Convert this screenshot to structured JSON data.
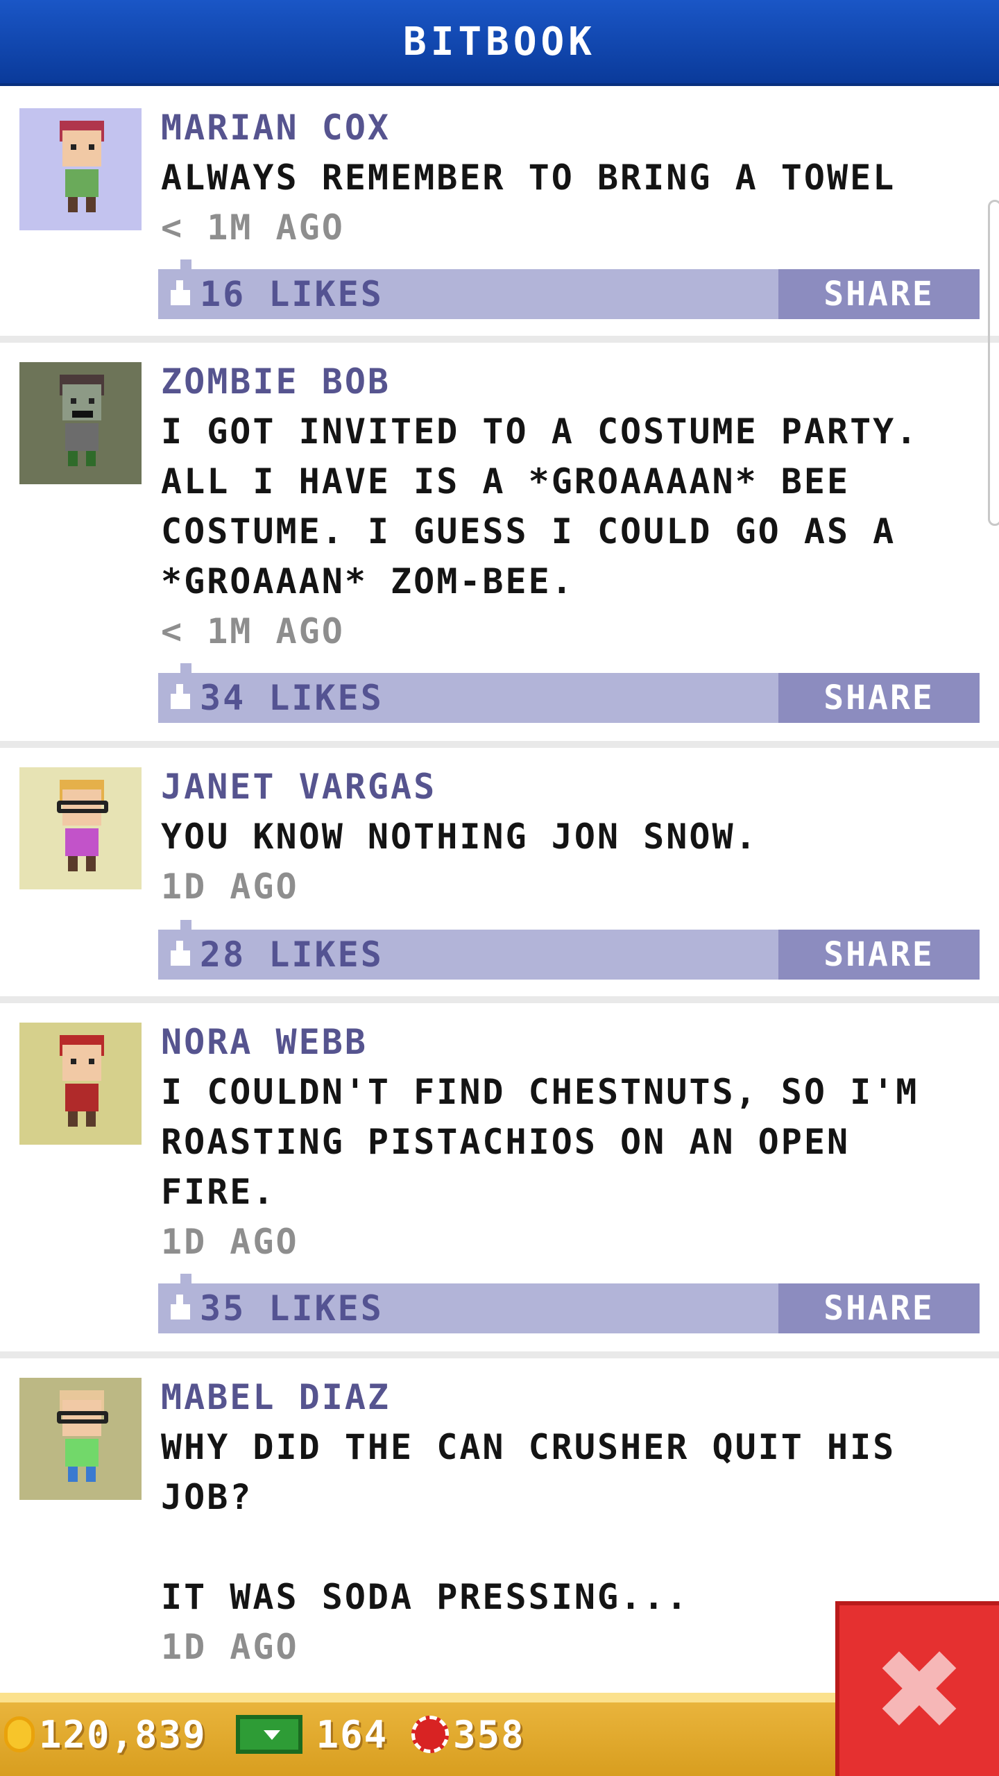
{
  "app": {
    "title": "BITBOOK"
  },
  "posts": [
    {
      "name": "MARIAN COX",
      "message": "ALWAYS REMEMBER TO BRING A TOWEL",
      "time": "< 1M AGO",
      "likes": "16 LIKES",
      "share_label": "SHARE",
      "avatar_bg": "#c3c3ef",
      "hair_color": "#b0354c",
      "shirt_color": "#6aaa5a"
    },
    {
      "name": "ZOMBIE BOB",
      "message": "I GOT INVITED TO A COSTUME PARTY.\nALL I HAVE IS A *GROAAAAN* BEE\nCOSTUME. I GUESS I COULD GO AS A\n*GROAAAN* ZOM-BEE.",
      "time": "< 1M AGO",
      "likes": "34 LIKES",
      "share_label": "SHARE",
      "avatar_bg": "#6d7458",
      "hair_color": "#4b3a3a",
      "shirt_color": "#6c6c6c"
    },
    {
      "name": "JANET VARGAS",
      "message": "YOU KNOW NOTHING JON SNOW.",
      "time": "1D AGO",
      "likes": "28 LIKES",
      "share_label": "SHARE",
      "avatar_bg": "#e7e3b4",
      "hair_color": "#e5b04a",
      "shirt_color": "#c253c9"
    },
    {
      "name": "NORA WEBB",
      "message": "I COULDN'T FIND CHESTNUTS, SO I'M\nROASTING PISTACHIOS ON AN OPEN\nFIRE.",
      "time": "1D AGO",
      "likes": "35 LIKES",
      "share_label": "SHARE",
      "avatar_bg": "#d6d08c",
      "hair_color": "#b82a2a",
      "shirt_color": "#b02a2a"
    },
    {
      "name": "MABEL DIAZ",
      "message": "WHY DID THE CAN CRUSHER QUIT HIS\nJOB?\n\nIT WAS SODA PRESSING...",
      "time": "1D AGO",
      "likes": "",
      "share_label": "",
      "avatar_bg": "#bcb884",
      "hair_color": "#e8c79a",
      "shirt_color": "#72d86a"
    }
  ],
  "footer": {
    "coins": "120,839",
    "cash": "164",
    "gems": "358"
  }
}
